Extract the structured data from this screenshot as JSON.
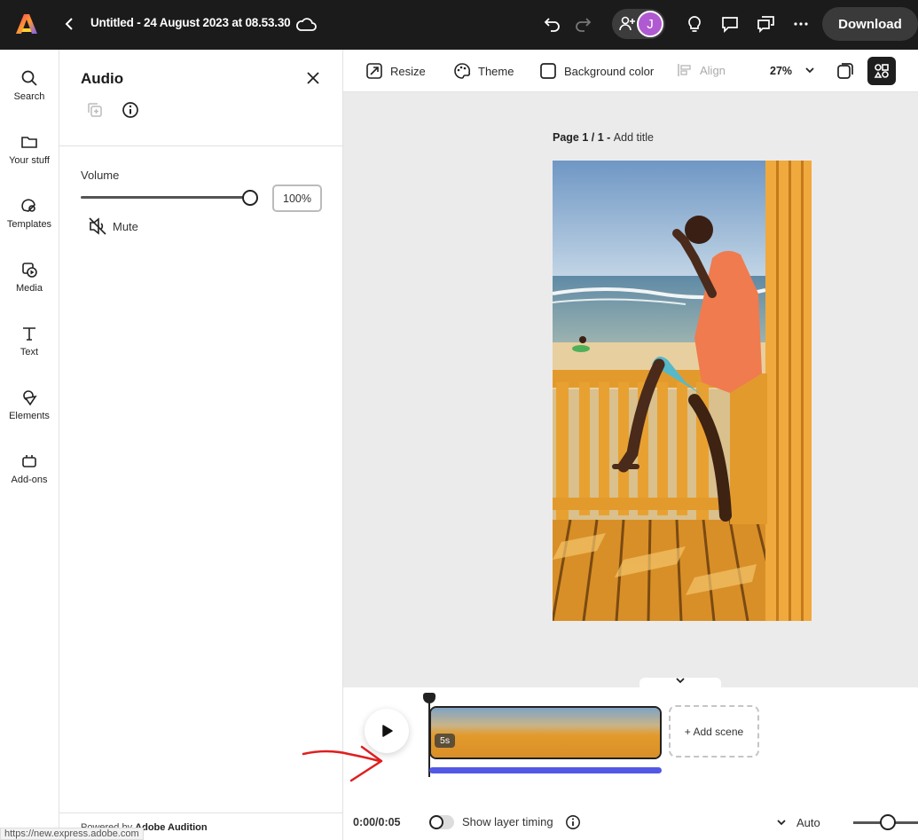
{
  "header": {
    "title": "Untitled - 24 August 2023 at 08.53.30",
    "avatar_initial": "J",
    "download_label": "Download"
  },
  "rail": {
    "items": [
      {
        "label": "Search",
        "icon": "search-icon"
      },
      {
        "label": "Your stuff",
        "icon": "folder-icon"
      },
      {
        "label": "Templates",
        "icon": "templates-icon"
      },
      {
        "label": "Media",
        "icon": "media-icon"
      },
      {
        "label": "Text",
        "icon": "text-icon"
      },
      {
        "label": "Elements",
        "icon": "elements-icon"
      },
      {
        "label": "Add-ons",
        "icon": "addons-icon"
      }
    ]
  },
  "audio_panel": {
    "title": "Audio",
    "volume_label": "Volume",
    "volume_value": "100%",
    "volume_level": 1.0,
    "mute_label": "Mute",
    "powered_prefix": "Powered by ",
    "powered_brand": "Adobe Audition"
  },
  "status_url": "https://new.express.adobe.com",
  "toolbar": {
    "resize_label": "Resize",
    "theme_label": "Theme",
    "background_label": "Background color",
    "align_label": "Align",
    "zoom_value": "27%"
  },
  "canvas": {
    "page_label": "Page 1 / 1 - ",
    "page_title_placeholder": "Add title"
  },
  "timeline": {
    "scene_duration": "5s",
    "add_scene_label": "+ Add scene",
    "time_code": "0:00/0:05",
    "show_layer_timing_label": "Show layer timing",
    "show_layer_timing_on": false,
    "auto_label": "Auto"
  },
  "colors": {
    "topbar": "#1b1b1b",
    "audio_bar": "#5258e4",
    "avatar": "#b05ad1",
    "annotation_arrow": "#e01e1e"
  }
}
